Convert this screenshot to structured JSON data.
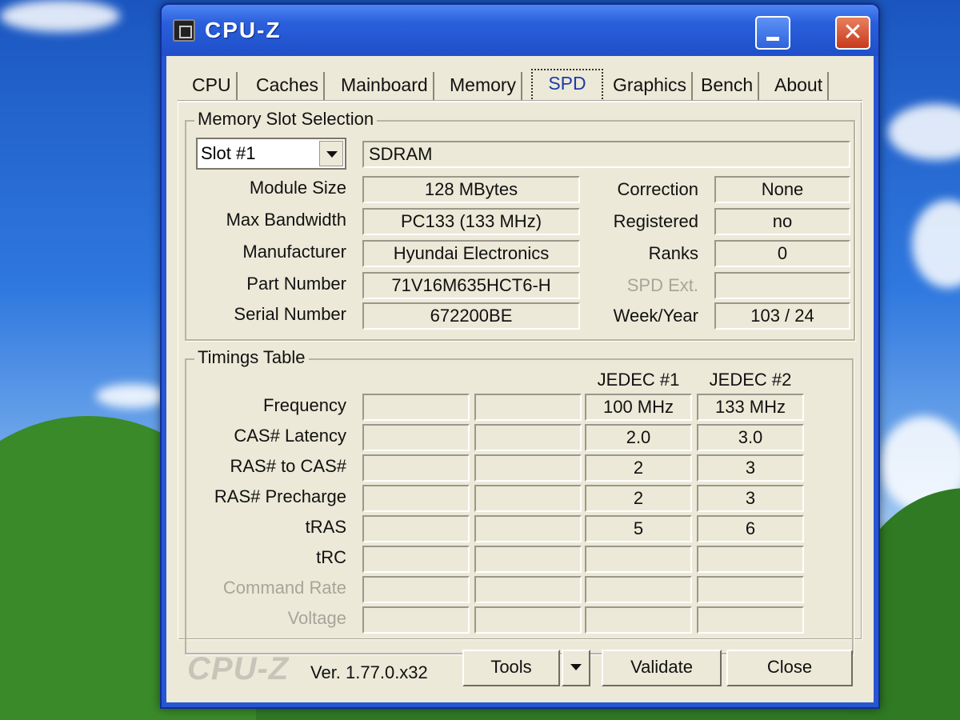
{
  "window": {
    "title": "CPU-Z"
  },
  "tabs": [
    {
      "label": "CPU"
    },
    {
      "label": "Caches"
    },
    {
      "label": "Mainboard"
    },
    {
      "label": "Memory"
    },
    {
      "label": "SPD"
    },
    {
      "label": "Graphics"
    },
    {
      "label": "Bench"
    },
    {
      "label": "About"
    }
  ],
  "active_tab": "SPD",
  "slot_selection": {
    "title": "Memory Slot Selection",
    "slot": "Slot #1",
    "memory_type": "SDRAM",
    "rows_left": [
      {
        "label": "Module Size",
        "value": "128 MBytes"
      },
      {
        "label": "Max Bandwidth",
        "value": "PC133 (133 MHz)"
      },
      {
        "label": "Manufacturer",
        "value": "Hyundai Electronics"
      },
      {
        "label": "Part Number",
        "value": "71V16M635HCT6-H"
      },
      {
        "label": "Serial Number",
        "value": "672200BE"
      }
    ],
    "rows_right": [
      {
        "label": "Correction",
        "value": "None"
      },
      {
        "label": "Registered",
        "value": "no"
      },
      {
        "label": "Ranks",
        "value": "0"
      },
      {
        "label": "SPD Ext.",
        "value": ""
      },
      {
        "label": "Week/Year",
        "value": "103 / 24"
      }
    ]
  },
  "timings": {
    "title": "Timings Table",
    "columns": [
      "",
      "",
      "JEDEC #1",
      "JEDEC #2"
    ],
    "rows": [
      {
        "label": "Frequency",
        "values": [
          "",
          "",
          "100 MHz",
          "133 MHz"
        ]
      },
      {
        "label": "CAS# Latency",
        "values": [
          "",
          "",
          "2.0",
          "3.0"
        ]
      },
      {
        "label": "RAS# to CAS#",
        "values": [
          "",
          "",
          "2",
          "3"
        ]
      },
      {
        "label": "RAS# Precharge",
        "values": [
          "",
          "",
          "2",
          "3"
        ]
      },
      {
        "label": "tRAS",
        "values": [
          "",
          "",
          "5",
          "6"
        ]
      },
      {
        "label": "tRC",
        "values": [
          "",
          "",
          "",
          ""
        ]
      },
      {
        "label": "Command Rate",
        "values": [
          "",
          "",
          "",
          ""
        ]
      },
      {
        "label": "Voltage",
        "values": [
          "",
          "",
          "",
          ""
        ]
      }
    ]
  },
  "footer": {
    "brand": "CPU-Z",
    "version": "Ver. 1.77.0.x32",
    "tools_label": "Tools",
    "validate_label": "Validate",
    "close_label": "Close"
  }
}
